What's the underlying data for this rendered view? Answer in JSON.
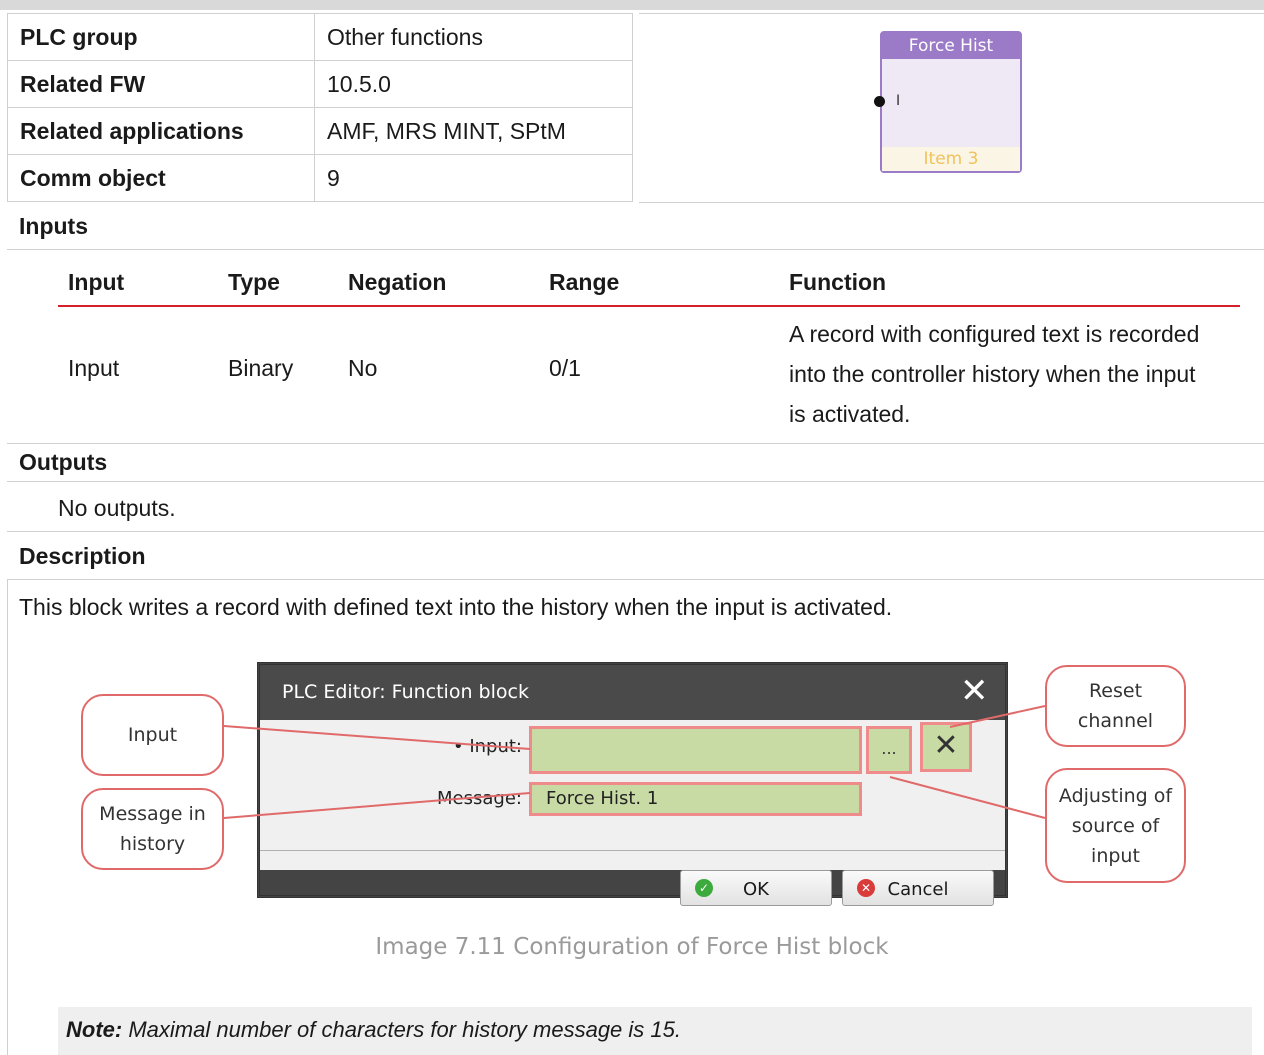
{
  "info": [
    {
      "key": "PLC group",
      "value": "Other functions"
    },
    {
      "key": "Related FW",
      "value": "10.5.0"
    },
    {
      "key": "Related applications",
      "value": "AMF, MRS MINT, SPtM"
    },
    {
      "key": "Comm object",
      "value": "9"
    }
  ],
  "block": {
    "title": "Force Hist",
    "pin": "I",
    "footer": "Item 3"
  },
  "inputs": {
    "heading": "Inputs",
    "columns": [
      "Input",
      "Type",
      "Negation",
      "Range",
      "Function"
    ],
    "row": {
      "input": "Input",
      "type": "Binary",
      "negation": "No",
      "range": "0/1",
      "function": "A record with configured text is recorded into the controller history when the input is activated."
    }
  },
  "outputs": {
    "heading": "Outputs",
    "text": "No outputs."
  },
  "description": {
    "heading": "Description",
    "text": "This block writes a record with defined text into the history when the input is activated."
  },
  "dialog": {
    "title": "PLC Editor: Function block",
    "input_label": "• Input:",
    "input_value": "",
    "message_label": "Message:",
    "message_value": "Force Hist. 1",
    "browse_label": "...",
    "ok_label": "OK",
    "cancel_label": "Cancel"
  },
  "callouts": {
    "input": "Input",
    "message": "Message in\nhistory",
    "reset": "Reset\nchannel",
    "adjust": "Adjusting of\nsource of\ninput"
  },
  "caption": "Image 7.11 Configuration of Force Hist block",
  "note": {
    "bold": "Note:",
    "text": " Maximal number of characters for history message is 15."
  }
}
